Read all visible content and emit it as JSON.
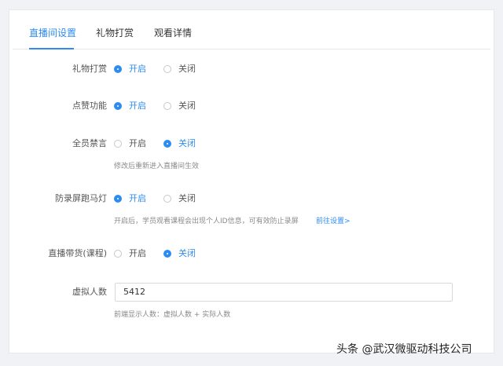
{
  "tabs": [
    {
      "label": "直播间设置",
      "active": true
    },
    {
      "label": "礼物打赏",
      "active": false
    },
    {
      "label": "观看详情",
      "active": false
    }
  ],
  "settings": {
    "gift": {
      "label": "礼物打赏",
      "on": "开启",
      "off": "关闭",
      "selected": "开启"
    },
    "like": {
      "label": "点赞功能",
      "on": "开启",
      "off": "关闭",
      "selected": "开启"
    },
    "mute": {
      "label": "全员禁言",
      "on": "开启",
      "off": "关闭",
      "selected": "关闭",
      "hint": "修改后重新进入直播间生效"
    },
    "antiRecord": {
      "label": "防录屏跑马灯",
      "on": "开启",
      "off": "关闭",
      "selected": "开启",
      "hint": "开启后，学员观看课程会出现个人ID信息，可有效防止录屏",
      "link": "前往设置>"
    },
    "goods": {
      "label": "直播带货(课程)",
      "on": "开启",
      "off": "关闭",
      "selected": "关闭"
    },
    "virtualViewers": {
      "label": "虚拟人数",
      "value": "5412",
      "hint": "前端显示人数：虚拟人数 + 实际人数"
    }
  },
  "watermark": "头条 @武汉微驱动科技公司",
  "colors": {
    "accent": "#2d8cf0",
    "background": "#f0f2f5"
  }
}
